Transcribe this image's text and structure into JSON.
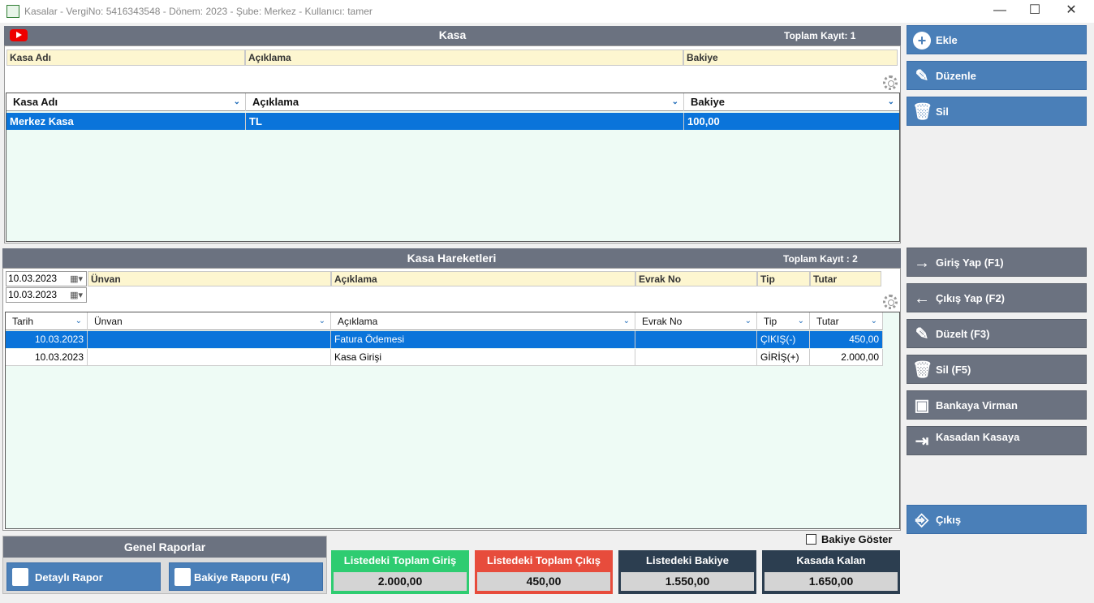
{
  "window": {
    "title": "Kasalar - VergiNo: 5416343548 - Dönem: 2023 - Şube: Merkez - Kullanıcı: tamer",
    "minimize": "—",
    "maximize": "☐",
    "close": "✕"
  },
  "kasa_panel": {
    "title": "Kasa",
    "count": "Toplam Kayıt:  1",
    "filters": [
      "Kasa Adı",
      "Açıklama",
      "Bakiye"
    ],
    "columns": [
      "Kasa Adı",
      "Açıklama",
      "Bakiye"
    ],
    "rows": [
      {
        "kasa_adi": "Merkez Kasa",
        "aciklama": "TL",
        "bakiye": "100,00"
      }
    ]
  },
  "hareket_panel": {
    "title": "Kasa Hareketleri",
    "count": "Toplam Kayıt : 2",
    "date_from": "10.03.2023",
    "date_to": "10.03.2023",
    "filters": [
      "Ünvan",
      "Açıklama",
      "Evrak No",
      "Tip",
      "Tutar"
    ],
    "columns": [
      "Tarih",
      "Ünvan",
      "Açıklama",
      "Evrak No",
      "Tip",
      "Tutar"
    ],
    "rows": [
      {
        "tarih": "10.03.2023",
        "unvan": "",
        "aciklama": "Fatura Ödemesi",
        "evrak_no": "",
        "tip": "ÇIKIŞ(-)",
        "tutar": "450,00"
      },
      {
        "tarih": "10.03.2023",
        "unvan": "",
        "aciklama": "Kasa Girişi",
        "evrak_no": "",
        "tip": "GİRİŞ(+)",
        "tutar": "2.000,00"
      }
    ]
  },
  "side_buttons_top": {
    "ekle": "Ekle",
    "duzenle": "Düzenle",
    "sil": "Sil"
  },
  "side_buttons_bottom": {
    "giris": "Giriş Yap (F1)",
    "cikis": "Çıkış Yap (F2)",
    "duzelt": "Düzelt (F3)",
    "sil": "Sil (F5)",
    "bankaya": "Bankaya Virman",
    "kasadan": "Kasadan Kasaya",
    "exit": "Çıkış"
  },
  "reports": {
    "title": "Genel Raporlar",
    "detayli": "Detaylı Rapor",
    "bakiye": "Bakiye Raporu (F4)"
  },
  "bakiye_goster": "Bakiye Göster",
  "summary": {
    "giris_label": "Listedeki Toplam Giriş",
    "giris_value": "2.000,00",
    "cikis_label": "Listedeki Toplam Çıkış",
    "cikis_value": "450,00",
    "bakiye_label": "Listedeki Bakiye",
    "bakiye_value": "1.550,00",
    "kalan_label": "Kasada Kalan",
    "kalan_value": "1.650,00"
  },
  "colors": {
    "giris": "#2ecc71",
    "cikis": "#e74c3c",
    "dark": "#2c3e50",
    "accent": "#4a7fb8",
    "selection": "#0a74da"
  }
}
